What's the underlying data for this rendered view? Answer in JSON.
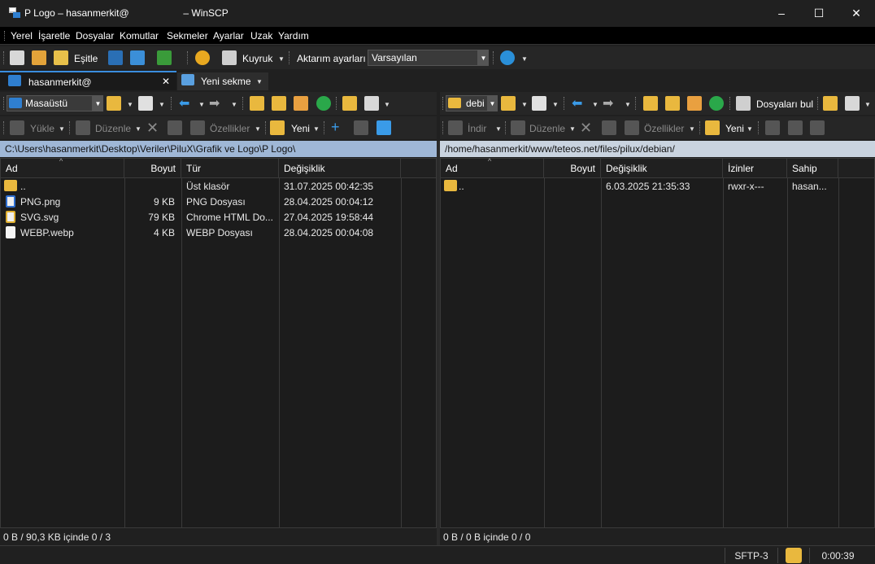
{
  "window": {
    "title": "P Logo – hasanmerkit@                    – WinSCP",
    "minimize": "–",
    "maximize": "☐",
    "close": "✕"
  },
  "menu": [
    "Yerel",
    "İşaretle",
    "Dosyalar",
    "Komutlar",
    "Sekmeler",
    "Ayarlar",
    "Uzak",
    "Yardım"
  ],
  "toolbar": {
    "sync_label": "Eşitle",
    "queue_label": "Kuyruk",
    "transfer_settings_label": "Aktarım ayarları",
    "transfer_preset": "Varsayılan"
  },
  "tabs": {
    "session": "hasanmerkit@",
    "new_tab": "Yeni sekme"
  },
  "left": {
    "drive": "Masaüstü",
    "upload": "Yükle",
    "edit": "Düzenle",
    "properties": "Özellikler",
    "new": "Yeni",
    "path": "C:\\Users\\hasanmerkit\\Desktop\\Veriler\\PiluX\\Grafik ve Logo\\P Logo\\",
    "columns": [
      "Ad",
      "Boyut",
      "Tür",
      "Değişiklik"
    ],
    "rows": [
      {
        "name": "..",
        "size": "",
        "type": "Üst klasör",
        "modified": "31.07.2025 00:42:35"
      },
      {
        "name": "PNG.png",
        "size": "9 KB",
        "type": "PNG Dosyası",
        "modified": "28.04.2025 00:04:12"
      },
      {
        "name": "SVG.svg",
        "size": "79 KB",
        "type": "Chrome HTML Do...",
        "modified": "27.04.2025 19:58:44"
      },
      {
        "name": "WEBP.webp",
        "size": "4 KB",
        "type": "WEBP Dosyası",
        "modified": "28.04.2025 00:04:08"
      }
    ],
    "status": "0 B / 90,3 KB içinde 0 / 3"
  },
  "right": {
    "drive": "debi",
    "find_files": "Dosyaları bul",
    "download": "İndir",
    "edit": "Düzenle",
    "properties": "Özellikler",
    "new": "Yeni",
    "path": "/home/hasanmerkit/www/teteos.net/files/pilux/debian/",
    "columns": [
      "Ad",
      "Boyut",
      "Değişiklik",
      "İzinler",
      "Sahip"
    ],
    "rows": [
      {
        "name": "..",
        "size": "",
        "modified": "6.03.2025 21:35:33",
        "perms": "rwxr-x---",
        "owner": "hasan..."
      }
    ],
    "status": "0 B / 0 B içinde 0 / 0"
  },
  "statusbar": {
    "protocol": "SFTP-3",
    "elapsed": "0:00:39"
  },
  "colors": {
    "path_bar": "#9fb7d6",
    "background": "#202020",
    "accent": "#1e90ff"
  }
}
